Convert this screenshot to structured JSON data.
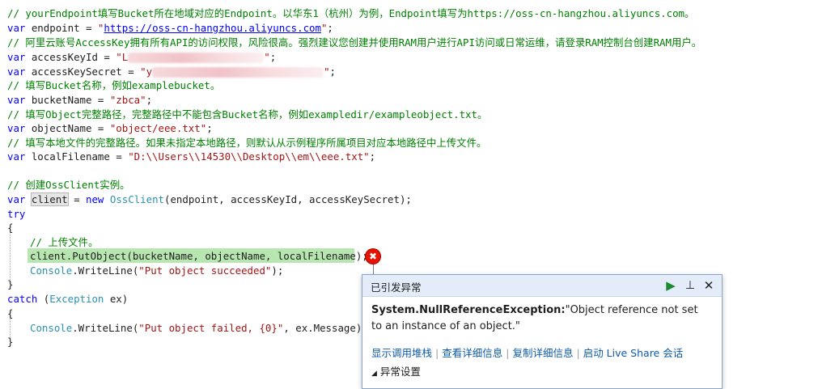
{
  "code": {
    "l1_comment": "// yourEndpoint填写Bucket所在地域对应的Endpoint。以华东1（杭州）为例，Endpoint填写为https://oss-cn-hangzhou.aliyuncs.com。",
    "l2_kw": "var",
    "l2_var": " endpoint = ",
    "l2_q1": "\"",
    "l2_url": "https://oss-cn-hangzhou.aliyuncs.com",
    "l2_q2": "\"",
    "l2_end": ";",
    "l3_comment": "// 阿里云账号AccessKey拥有所有API的访问权限，风险很高。强烈建议您创建并使用RAM用户进行API访问或日常运维，请登录RAM控制台创建RAM用户。",
    "l4_kw": "var",
    "l4_var": " accessKeyId = ",
    "l4_str_start": "\"L",
    "l4_str_end": "\"",
    "l4_end": ";",
    "l5_kw": "var",
    "l5_var": " accessKeySecret = ",
    "l5_str_start": "\"y",
    "l5_str_end": "\"",
    "l5_end": ";",
    "l6_comment": "// 填写Bucket名称，例如examplebucket。",
    "l7_kw": "var",
    "l7_var": " bucketName = ",
    "l7_str": "\"zbca\"",
    "l7_end": ";",
    "l8_comment": "// 填写Object完整路径，完整路径中不能包含Bucket名称，例如exampledir/exampleobject.txt。",
    "l9_kw": "var",
    "l9_var": " objectName = ",
    "l9_str": "\"object/eee.txt\"",
    "l9_end": ";",
    "l10_comment": "// 填写本地文件的完整路径。如果未指定本地路径，则默认从示例程序所属项目对应本地路径中上传文件。",
    "l11_kw": "var",
    "l11_var": " localFilename = ",
    "l11_str": "\"D:\\\\Users\\\\14530\\\\Desktop\\\\em\\\\eee.txt\"",
    "l11_end": ";",
    "l13_comment": "// 创建OssClient实例。",
    "l14_kw": "var",
    "l14_sp": " ",
    "l14_client": "client",
    "l14_eq": " = ",
    "l14_new": "new",
    "l14_sp2": " ",
    "l14_cls": "OssClient",
    "l14_args": "(endpoint, accessKeyId, accessKeySecret);",
    "l15_try": "try",
    "l16_brace": "{",
    "l17_comment": "// 上传文件。",
    "l18_code": "client.PutObject(bucketName, objectName, localFilename);",
    "l19_cls": "Console",
    "l19_mid": ".WriteLine(",
    "l19_str": "\"Put object succeeded\"",
    "l19_end": ");",
    "l20_brace": "}",
    "l21_catch": "catch",
    "l21_sp": " (",
    "l21_cls": "Exception",
    "l21_rest": " ex)",
    "l22_brace": "{",
    "l23_cls": "Console",
    "l23_mid": ".WriteLine(",
    "l23_str": "\"Put object failed, {0}\"",
    "l23_end": ", ex.Message);",
    "l24_brace": "}"
  },
  "exception": {
    "icon_glyph": "✖",
    "title": "已引发异常",
    "continue_glyph": "▶",
    "pin_glyph": "⊥",
    "close_glyph": "✕",
    "type": "System.NullReferenceException:",
    "message": "\"Object reference not set to an instance of an object.\"",
    "actions": [
      "显示调用堆栈",
      "查看详细信息",
      "复制详细信息",
      "启动 Live Share 会话"
    ],
    "settings_glyph": "◢",
    "settings_label": "异常设置"
  },
  "colors": {
    "keyword": "#0000ff",
    "string": "#a31515",
    "comment": "#008000",
    "type": "#2b91af",
    "exec_highlight": "#b8e6b0",
    "error": "#e51400"
  }
}
